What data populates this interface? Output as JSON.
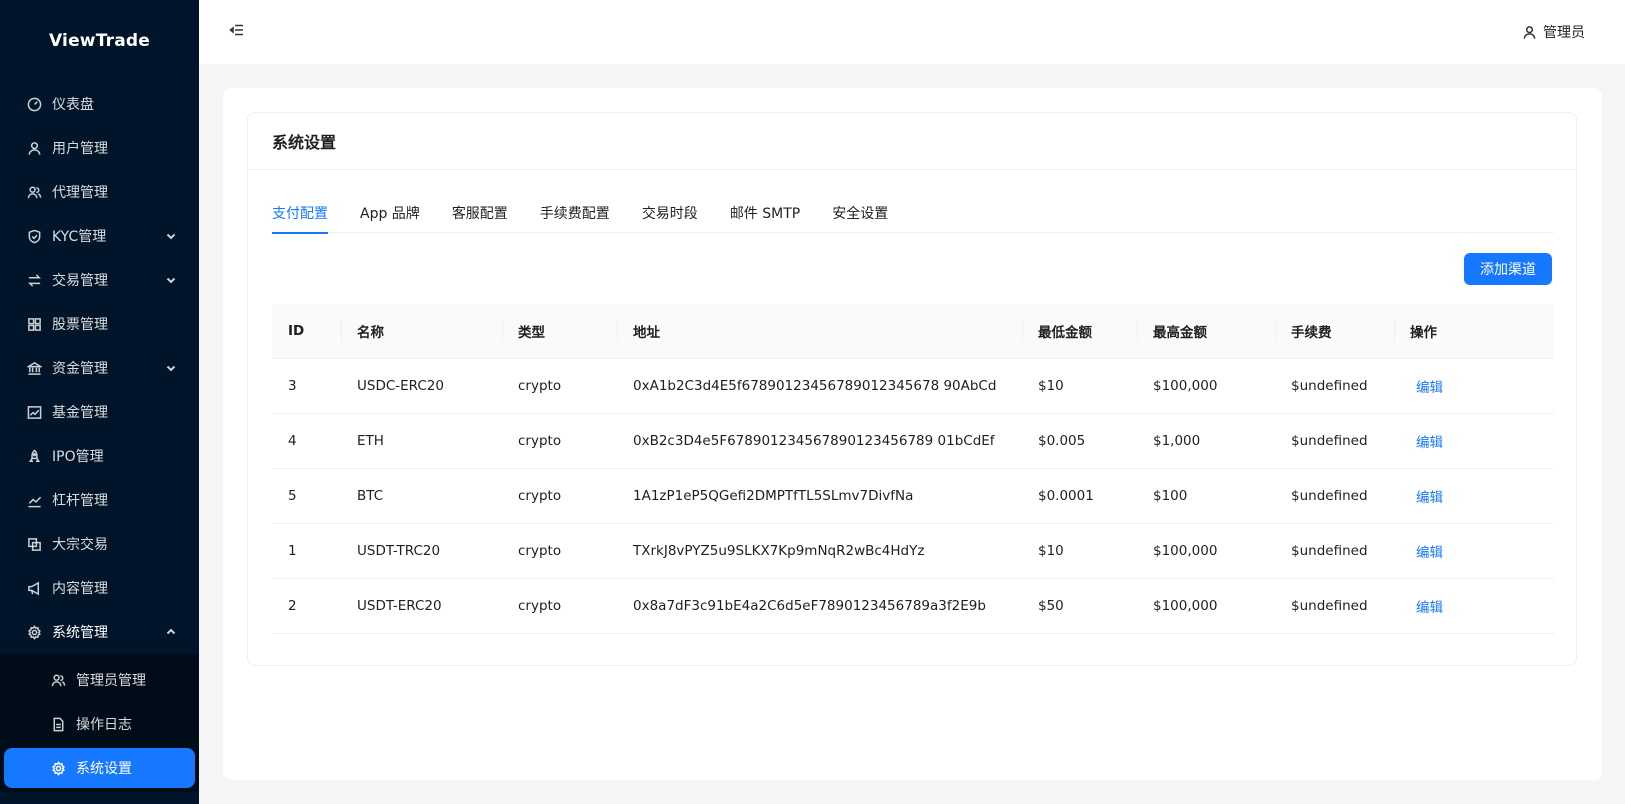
{
  "app": {
    "logo": "ViewTrade"
  },
  "sidebar": {
    "items": [
      {
        "label": "仪表盘",
        "icon": "dashboard-icon"
      },
      {
        "label": "用户管理",
        "icon": "user-icon"
      },
      {
        "label": "代理管理",
        "icon": "team-icon"
      },
      {
        "label": "KYC管理",
        "icon": "shield-icon",
        "expandable": true
      },
      {
        "label": "交易管理",
        "icon": "swap-icon",
        "expandable": true
      },
      {
        "label": "股票管理",
        "icon": "grid-icon"
      },
      {
        "label": "资金管理",
        "icon": "bank-icon",
        "expandable": true
      },
      {
        "label": "基金管理",
        "icon": "stock-chart-icon"
      },
      {
        "label": "IPO管理",
        "icon": "rocket-icon"
      },
      {
        "label": "杠杆管理",
        "icon": "line-chart-icon"
      },
      {
        "label": "大宗交易",
        "icon": "block-icon"
      },
      {
        "label": "内容管理",
        "icon": "notification-icon"
      },
      {
        "label": "系统管理",
        "icon": "setting-icon",
        "expanded": true
      }
    ],
    "submenu": [
      {
        "label": "管理员管理",
        "icon": "team-icon"
      },
      {
        "label": "操作日志",
        "icon": "file-icon"
      },
      {
        "label": "系统设置",
        "icon": "setting-icon",
        "active": true
      }
    ]
  },
  "header": {
    "user": "管理员"
  },
  "page": {
    "title": "系统设置",
    "tabs": [
      "支付配置",
      "App 品牌",
      "客服配置",
      "手续费配置",
      "交易时段",
      "邮件 SMTP",
      "安全设置"
    ],
    "active_tab": "支付配置",
    "add_button": "添加渠道"
  },
  "table": {
    "columns": [
      "ID",
      "名称",
      "类型",
      "地址",
      "最低金额",
      "最高金额",
      "手续费",
      "操作"
    ],
    "rows": [
      {
        "id": "3",
        "name": "USDC-ERC20",
        "type": "crypto",
        "address": "0xA1b2C3d4E5f67890123456789012345678 90AbCd",
        "min": "$10",
        "max": "$100,000",
        "fee": "$undefined",
        "action": "编辑"
      },
      {
        "id": "4",
        "name": "ETH",
        "type": "crypto",
        "address": "0xB2c3D4e5F678901234567890123456789 01bCdEf",
        "min": "$0.005",
        "max": "$1,000",
        "fee": "$undefined",
        "action": "编辑"
      },
      {
        "id": "5",
        "name": "BTC",
        "type": "crypto",
        "address": "1A1zP1eP5QGefi2DMPTfTL5SLmv7DivfNa",
        "min": "$0.0001",
        "max": "$100",
        "fee": "$undefined",
        "action": "编辑"
      },
      {
        "id": "1",
        "name": "USDT-TRC20",
        "type": "crypto",
        "address": "TXrkJ8vPYZ5u9SLKX7Kp9mNqR2wBc4HdYz",
        "min": "$10",
        "max": "$100,000",
        "fee": "$undefined",
        "action": "编辑"
      },
      {
        "id": "2",
        "name": "USDT-ERC20",
        "type": "crypto",
        "address": "0x8a7dF3c91bE4a2C6d5eF7890123456789a3f2E9b",
        "min": "$50",
        "max": "$100,000",
        "fee": "$undefined",
        "action": "编辑"
      }
    ]
  },
  "colors": {
    "sidebar_bg": "#001529",
    "primary": "#1677ff"
  }
}
